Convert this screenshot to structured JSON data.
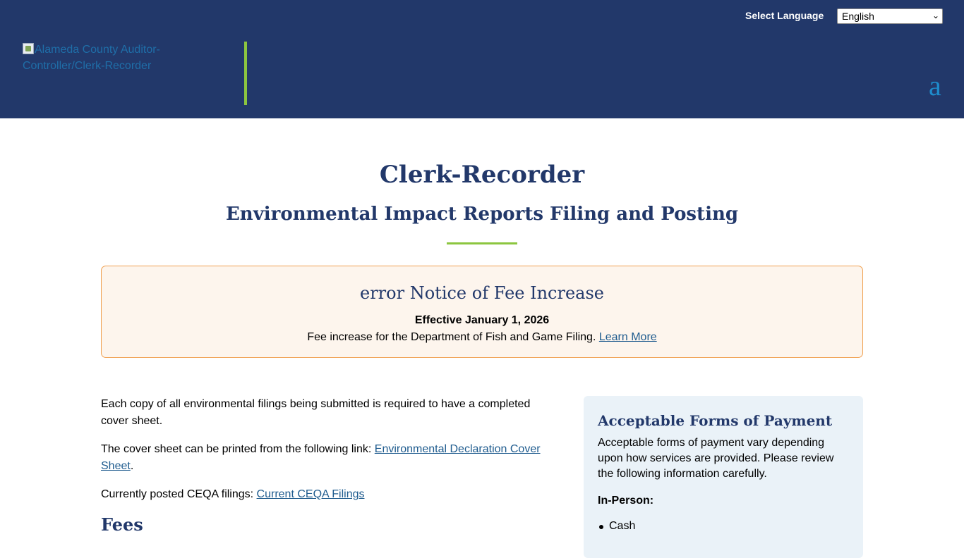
{
  "header": {
    "language_label": "Select Language",
    "language_selected": "English",
    "logo_alt": "Alameda County Auditor-Controller/Clerk-Recorder",
    "accessibility_icon_glyph": "a"
  },
  "page": {
    "title": "Clerk-Recorder",
    "subtitle": "Environmental Impact Reports Filing and Posting"
  },
  "notice": {
    "icon_text": "error",
    "title": "Notice of Fee Increase",
    "effective": "Effective January 1, 2026",
    "text": "Fee increase for the Department of Fish and Game Filing.",
    "link": "Learn More"
  },
  "main": {
    "para1": "Each copy of all environmental filings being submitted is required to have a completed cover sheet.",
    "para2_text": "The cover sheet can be printed from the following link:",
    "para2_link": "Environmental Declaration Cover Sheet",
    "para3_text": "Currently posted CEQA filings:",
    "para3_link": "Current CEQA Filings",
    "fees_heading": "Fees"
  },
  "sidebar": {
    "title": "Acceptable Forms of Payment",
    "text": "Acceptable forms of payment vary depending upon how services are provided. Please review the following information carefully.",
    "in_person_label": "In-Person:",
    "in_person_items": [
      "Cash"
    ]
  },
  "colors": {
    "header_bg": "#22386a",
    "accent_green": "#8cc63f",
    "heading_navy": "#22386a",
    "link_blue": "#1e5b8e",
    "notice_border": "#f0a050",
    "notice_bg": "#fdf5ed",
    "sidebar_bg": "#eaf2f8"
  }
}
